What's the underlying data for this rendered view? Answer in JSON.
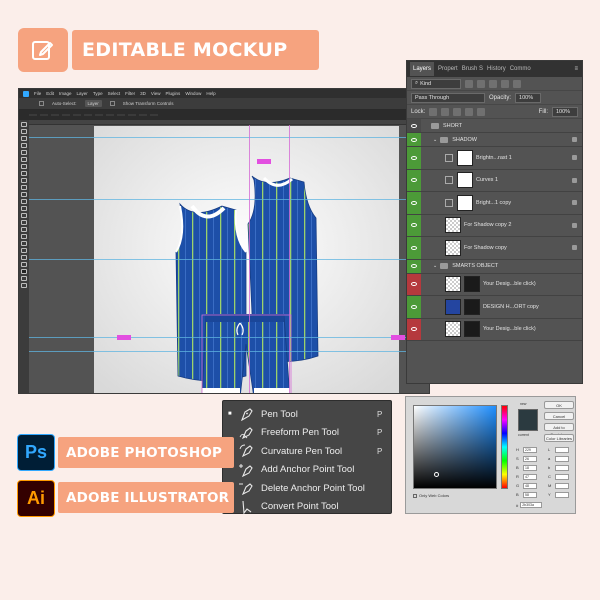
{
  "banner": {
    "title": "EDITABLE MOCKUP",
    "icon": "edit-icon",
    "color": "#f6a37f"
  },
  "apps": [
    {
      "abbr": "Ps",
      "label": "ADOBE PHOTOSHOP",
      "fg": "#31a8ff",
      "bg": "#001e36"
    },
    {
      "abbr": "Ai",
      "label": "ADOBE ILLUSTRATOR",
      "fg": "#ff9a00",
      "bg": "#330000"
    }
  ],
  "photoshop": {
    "menu": [
      "File",
      "Edit",
      "Image",
      "Layer",
      "Type",
      "Select",
      "Filter",
      "3D",
      "View",
      "Plugins",
      "Window",
      "Help"
    ],
    "options": {
      "auto_select": "Auto-Select:",
      "layer": "Layer",
      "transform": "Show Transform Controls"
    }
  },
  "layers_panel": {
    "tabs": [
      "Layers",
      "Propert",
      "Brush S",
      "History",
      "Commo"
    ],
    "kind": "Kind",
    "blend_mode": "Pass Through",
    "opacity_label": "Opacity:",
    "opacity": "100%",
    "lock_label": "Lock:",
    "fill_label": "Fill:",
    "fill": "100%",
    "layers": [
      {
        "name": "SHORT",
        "type": "group",
        "eye": "gray",
        "indent": 0
      },
      {
        "name": "SHADOW",
        "type": "group",
        "eye": "green",
        "indent": 1
      },
      {
        "name": "Brightn...rast 1",
        "type": "adjustment",
        "eye": "green",
        "indent": 2
      },
      {
        "name": "Curves 1",
        "type": "adjustment",
        "eye": "green",
        "indent": 2
      },
      {
        "name": "Bright...1 copy",
        "type": "adjustment",
        "eye": "green",
        "indent": 2
      },
      {
        "name": "For Shadow copy 2",
        "type": "layer",
        "eye": "green",
        "indent": 2
      },
      {
        "name": "For Shadow copy",
        "type": "layer",
        "eye": "green",
        "indent": 2
      },
      {
        "name": "SMARTS OBJECT",
        "type": "group",
        "eye": "green",
        "indent": 1
      },
      {
        "name": "Your Desig...ble click)",
        "type": "smart",
        "eye": "red",
        "indent": 2
      },
      {
        "name": "DESIGN H...ORT copy",
        "type": "smart",
        "eye": "green",
        "indent": 2
      },
      {
        "name": "Your Desig...ble click)",
        "type": "smart",
        "eye": "red",
        "indent": 2
      }
    ]
  },
  "color_picker": {
    "buttons": [
      "OK",
      "Cancel",
      "Add to Swatches",
      "Color Libraries"
    ],
    "labels": {
      "new": "new",
      "current": "current"
    },
    "fields": [
      {
        "name": "H",
        "value": "229"
      },
      {
        "name": "L",
        "value": ""
      },
      {
        "name": "S",
        "value": "26"
      },
      {
        "name": "a",
        "value": ""
      },
      {
        "name": "B",
        "value": "18"
      },
      {
        "name": "b",
        "value": ""
      },
      {
        "name": "R",
        "value": "47"
      },
      {
        "name": "C",
        "value": ""
      },
      {
        "name": "G",
        "value": "48"
      },
      {
        "name": "M",
        "value": ""
      },
      {
        "name": "B",
        "value": "58"
      },
      {
        "name": "Y",
        "value": ""
      }
    ],
    "hex": "2b303a",
    "only_web": "Only Web Colors"
  },
  "pen_menu": {
    "items": [
      {
        "label": "Pen Tool",
        "key": "P",
        "active": true,
        "icon": "pen-icon"
      },
      {
        "label": "Freeform Pen Tool",
        "key": "P",
        "active": false,
        "icon": "freeform-pen-icon"
      },
      {
        "label": "Curvature Pen Tool",
        "key": "P",
        "active": false,
        "icon": "curvature-pen-icon"
      },
      {
        "label": "Add Anchor Point Tool",
        "key": "",
        "active": false,
        "icon": "add-anchor-icon"
      },
      {
        "label": "Delete Anchor Point Tool",
        "key": "",
        "active": false,
        "icon": "delete-anchor-icon"
      },
      {
        "label": "Convert Point Tool",
        "key": "",
        "active": false,
        "icon": "convert-point-icon"
      }
    ]
  }
}
